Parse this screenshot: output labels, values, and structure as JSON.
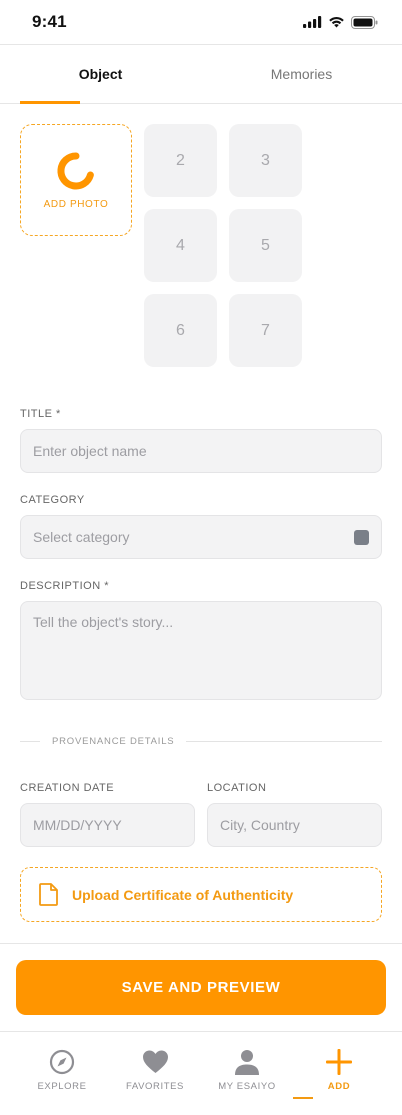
{
  "status_bar": {
    "time": "9:41"
  },
  "tabs": [
    {
      "label": "Object",
      "active": true
    },
    {
      "label": "Memories",
      "active": false
    }
  ],
  "photos": {
    "add_label": "ADD PHOTO",
    "slots": [
      "2",
      "3",
      "4",
      "5",
      "6",
      "7"
    ]
  },
  "form": {
    "title": {
      "label": "TITLE *",
      "placeholder": "Enter object name"
    },
    "category": {
      "label": "CATEGORY",
      "placeholder": "Select category"
    },
    "description": {
      "label": "DESCRIPTION *",
      "placeholder": "Tell the object's story..."
    },
    "provenance_heading": "PROVENANCE DETAILS",
    "creation_date": {
      "label": "CREATION DATE",
      "placeholder": "MM/DD/YYYY"
    },
    "location": {
      "label": "LOCATION",
      "placeholder": "City, Country"
    },
    "upload_certificate": "Upload Certificate of Authenticity"
  },
  "save_button": "SAVE AND PREVIEW",
  "bottom_nav": [
    {
      "label": "EXPLORE",
      "icon": "compass-icon",
      "active": false
    },
    {
      "label": "FAVORITES",
      "icon": "heart-icon",
      "active": false
    },
    {
      "label": "MY ESAIYO",
      "icon": "user-icon",
      "active": false
    },
    {
      "label": "ADD",
      "icon": "plus-icon",
      "active": true
    }
  ],
  "colors": {
    "accent": "#ff9500",
    "field_bg": "#f3f3f4",
    "muted": "#8e8e93"
  }
}
